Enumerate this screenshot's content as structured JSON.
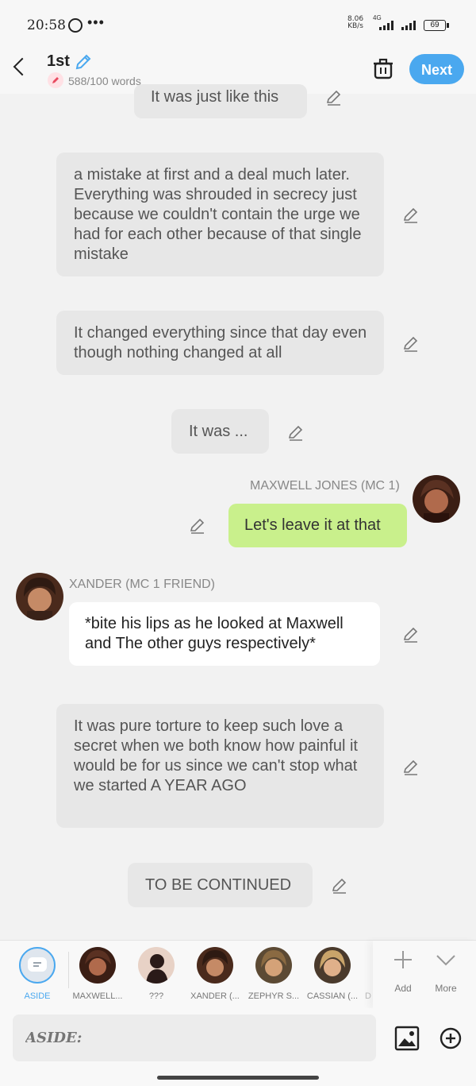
{
  "status_bar": {
    "time": "20:58",
    "more": "•••",
    "speed_top": "8.06",
    "speed_bottom": "KB/s",
    "network": "4G",
    "battery": "69"
  },
  "header": {
    "title": "1st",
    "word_count": "588/100 words",
    "next_label": "Next"
  },
  "messages": [
    {
      "type": "narration",
      "text": "It was just like this"
    },
    {
      "type": "narration",
      "text": "a mistake at first and a deal much later. Everything was shrouded in secrecy just because we couldn't contain the urge we had for each other because of that single mistake"
    },
    {
      "type": "narration",
      "text": "It changed everything since that day even though nothing changed at all"
    },
    {
      "type": "narration",
      "text": "It was ..."
    },
    {
      "type": "outgoing",
      "speaker": "MAXWELL JONES (MC 1)",
      "text": "Let's leave it at that"
    },
    {
      "type": "incoming",
      "speaker": "XANDER (MC 1 FRIEND)",
      "text": "*bite his lips as he looked at Maxwell and The other guys respectively*"
    },
    {
      "type": "narration",
      "text": "It was pure torture to keep such love a secret when we both know how painful it would be for us since we can't stop what we started A YEAR AGO"
    },
    {
      "type": "narration",
      "text": "TO BE CONTINUED"
    }
  ],
  "cast": [
    {
      "label": "ASIDE",
      "color": "#4aa8ef"
    },
    {
      "label": "MAXWELL..."
    },
    {
      "label": "???"
    },
    {
      "label": "XANDER (..."
    },
    {
      "label": "ZEPHYR S..."
    },
    {
      "label": "CASSIAN (..."
    },
    {
      "label": "D"
    }
  ],
  "cast_actions": {
    "add": "Add",
    "more": "More"
  },
  "composer": {
    "placeholder": "ASIDE:"
  },
  "icons": [
    "whatsapp-icon",
    "back-icon",
    "pencil-icon",
    "trash-icon",
    "image-icon",
    "plus-circle-icon",
    "chevron-down-icon",
    "plus-icon"
  ],
  "colors": {
    "accent": "#4aa8ef",
    "outgoing_bubble": "#c9f08c",
    "incoming_bubble": "#ffffff",
    "narration_bubble": "#e7e7e7"
  }
}
